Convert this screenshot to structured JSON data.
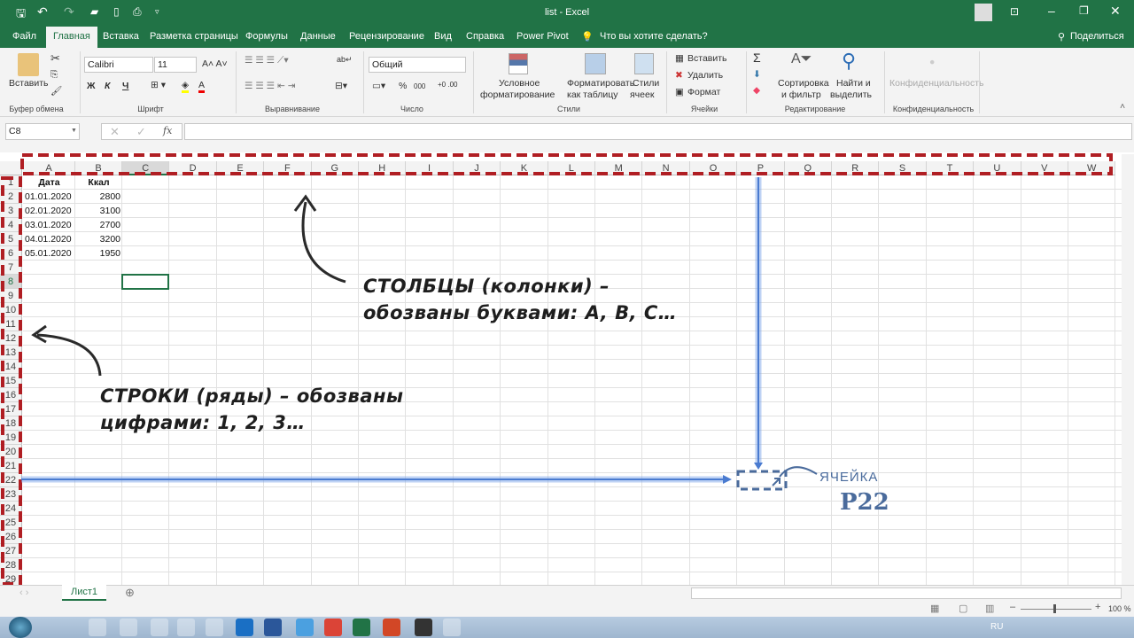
{
  "window": {
    "title": "list  -  Excel"
  },
  "ribbon_tabs": [
    "Файл",
    "Главная",
    "Вставка",
    "Разметка страницы",
    "Формулы",
    "Данные",
    "Рецензирование",
    "Вид",
    "Справка",
    "Power Pivot"
  ],
  "active_tab": "Главная",
  "tell_me": "Что вы хотите сделать?",
  "share": "Поделиться",
  "ribbon": {
    "paste": "Вставить",
    "clipboard": "Буфер обмена",
    "font_name": "Calibri",
    "font_size": "11",
    "bold": "Ж",
    "italic": "К",
    "underline": "Ч",
    "font": "Шрифт",
    "alignment": "Выравнивание",
    "number_format": "Общий",
    "percent": "%",
    "thousands": "000",
    "number": "Число",
    "cond_format_1": "Условное",
    "cond_format_2": "форматирование",
    "format_table_1": "Форматировать",
    "format_table_2": "как таблицу",
    "cell_styles_1": "Стили",
    "cell_styles_2": "ячеек",
    "styles": "Стили",
    "insert": "Вставить",
    "delete": "Удалить",
    "format": "Формат",
    "cells": "Ячейки",
    "sort_1": "Сортировка",
    "sort_2": "и фильтр",
    "find_1": "Найти и",
    "find_2": "выделить",
    "editing": "Редактирование",
    "sensitivity": "Конфиденциальность",
    "sensitivity_group": "Конфиденциальность"
  },
  "formula_bar": {
    "name_box": "C8",
    "value": ""
  },
  "columns": [
    "A",
    "B",
    "C",
    "D",
    "E",
    "F",
    "G",
    "H",
    "I",
    "J",
    "K",
    "L",
    "M",
    "N",
    "O",
    "P",
    "Q",
    "R",
    "S",
    "T",
    "U",
    "V",
    "W"
  ],
  "rows": [
    "1",
    "2",
    "3",
    "4",
    "5",
    "6",
    "7",
    "8",
    "9",
    "10",
    "11",
    "12",
    "13",
    "14",
    "15",
    "16",
    "17",
    "18",
    "19",
    "20",
    "21",
    "22",
    "23",
    "24",
    "25",
    "26",
    "27",
    "28",
    "29"
  ],
  "selected_cell": "C8",
  "table": {
    "headers": [
      "Дата",
      "Ккал"
    ],
    "rows": [
      [
        "01.01.2020",
        "2800"
      ],
      [
        "02.01.2020",
        "3100"
      ],
      [
        "03.01.2020",
        "2700"
      ],
      [
        "04.01.2020",
        "3200"
      ],
      [
        "05.01.2020",
        "1950"
      ]
    ]
  },
  "annotations": {
    "columns_1": "СТОЛБЦЫ (колонки) –",
    "columns_2": "обозваны буквами: A, B, C…",
    "rows_1": "СТРОКИ (ряды) – обозваны",
    "rows_2": "цифрами: 1, 2, 3…",
    "cell_label": "ЯЧЕЙКА",
    "cell_ref": "P22",
    "colors": {
      "box": "#b01e23",
      "line": "#4a7bd0",
      "cell_text": "#4a6b9c"
    }
  },
  "sheets": [
    "Лист1"
  ],
  "status": {
    "zoom": "100 %",
    "lang": "RU"
  }
}
